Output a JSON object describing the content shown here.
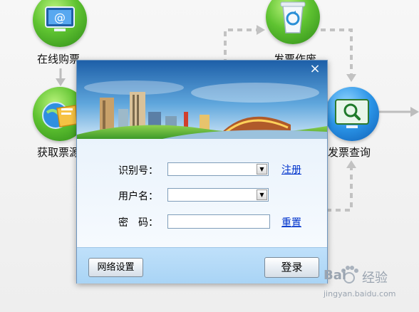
{
  "background": {
    "nodes": [
      {
        "label": "在线购票",
        "icon": "monitor-email-icon",
        "color": "green"
      },
      {
        "label": "发票作废",
        "icon": "recycle-bin-icon",
        "color": "green"
      },
      {
        "label": "获取票源",
        "icon": "globe-folder-icon",
        "color": "green"
      },
      {
        "label": "发票查询",
        "icon": "magnifier-monitor-icon",
        "color": "blue"
      }
    ]
  },
  "dialog": {
    "close_symbol": "×",
    "labels": {
      "id_number": "识别号：",
      "username": "用户名：",
      "password": "密　码："
    },
    "fields": {
      "id_number_value": "",
      "username_value": "",
      "password_value": ""
    },
    "links": {
      "register": "注册",
      "reset": "重置"
    },
    "buttons": {
      "network_settings": "网络设置",
      "login": "登录"
    }
  },
  "watermark": {
    "brand": "Bai",
    "brand_cn": "经验",
    "url": "jingyan.baidu.com"
  }
}
